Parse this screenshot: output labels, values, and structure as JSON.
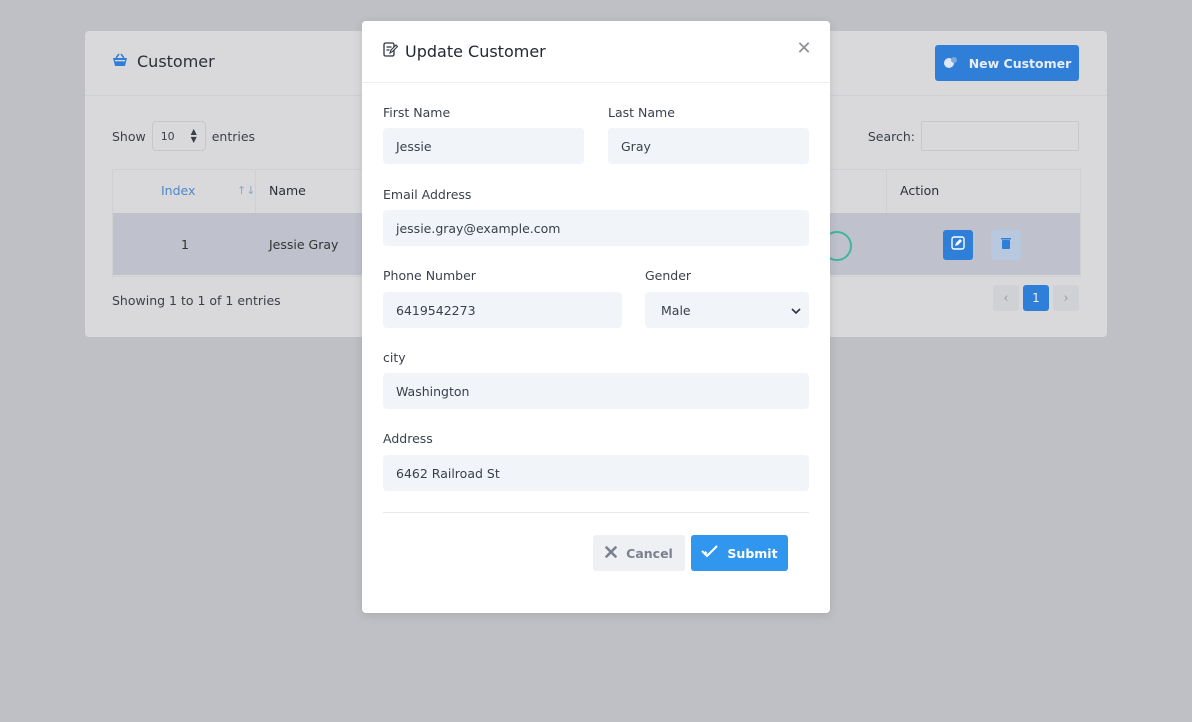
{
  "page": {
    "card_title": "Customer",
    "new_button": "New Customer",
    "show_label": "Show",
    "show_value": "10",
    "entries_label": "entries",
    "search_label": "Search:",
    "columns": {
      "index": "Index",
      "name": "Name",
      "action": "Action"
    },
    "rows": [
      {
        "index": "1",
        "name": "Jessie Gray"
      }
    ],
    "showing": "Showing 1 to 1 of 1 entries",
    "pagination": {
      "prev": "‹",
      "current": "1",
      "next": "›"
    }
  },
  "modal": {
    "title": "Update Customer",
    "fields": {
      "first_name": {
        "label": "First Name",
        "value": "Jessie"
      },
      "last_name": {
        "label": "Last Name",
        "value": "Gray"
      },
      "email": {
        "label": "Email Address",
        "value": "jessie.gray@example.com"
      },
      "phone": {
        "label": "Phone Number",
        "value": "6419542273"
      },
      "gender": {
        "label": "Gender",
        "value": "Male"
      },
      "city": {
        "label": "city",
        "value": "Washington"
      },
      "address": {
        "label": "Address",
        "value": "6462 Railroad St"
      }
    },
    "cancel": "Cancel",
    "submit": "Submit"
  },
  "colors": {
    "primary": "#2f7fd8",
    "submit": "#3196ee",
    "overlay": "#bfc0c5",
    "input_bg": "#f1f4f8"
  },
  "icons": [
    "basket-icon",
    "toggle-icon",
    "sort-icon",
    "edit-icon",
    "trash-icon",
    "edit-document-icon",
    "close-icon",
    "x-icon",
    "check-icon",
    "chevron-down-icon"
  ]
}
